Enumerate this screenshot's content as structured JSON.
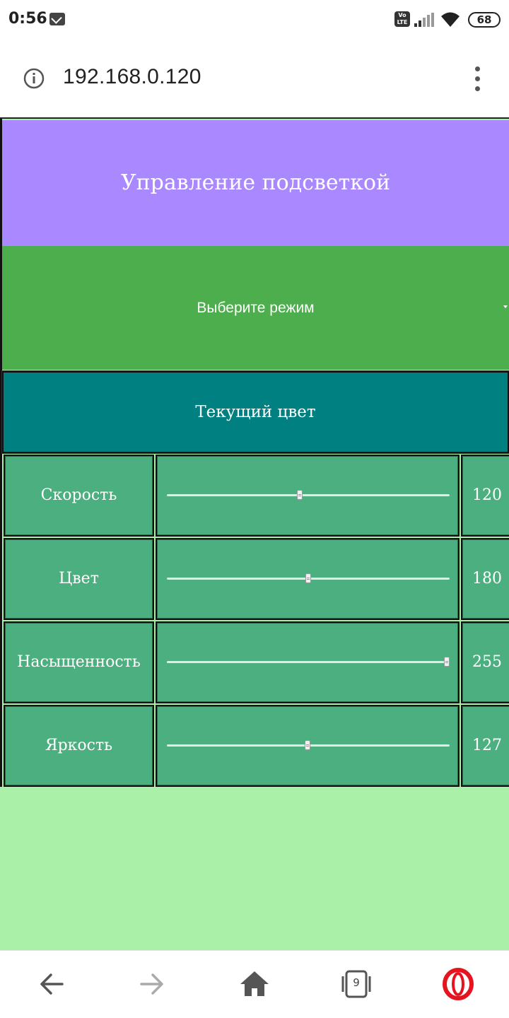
{
  "status_bar": {
    "time": "0:56",
    "network": "Vo LTE",
    "battery": "68"
  },
  "browser": {
    "url": "192.168.0.120",
    "tab_count": "9"
  },
  "page": {
    "title": "Управление подсветкой",
    "mode_select": "Выберите режим",
    "current_color_label": "Текущий цвет",
    "sliders": [
      {
        "label": "Скорость",
        "value": "120",
        "position": 0.471
      },
      {
        "label": "Цвет",
        "value": "180",
        "position": 0.5
      },
      {
        "label": "Насыщенность",
        "value": "255",
        "position": 0.99
      },
      {
        "label": "Яркость",
        "value": "127",
        "position": 0.498
      }
    ]
  },
  "colors": {
    "header": "#aa88ff",
    "mode_bar": "#4cae4c",
    "current_color": "#008080",
    "rows": "#4caf7f",
    "background": "#aaf0a8",
    "opera_red": "#e5141e"
  }
}
